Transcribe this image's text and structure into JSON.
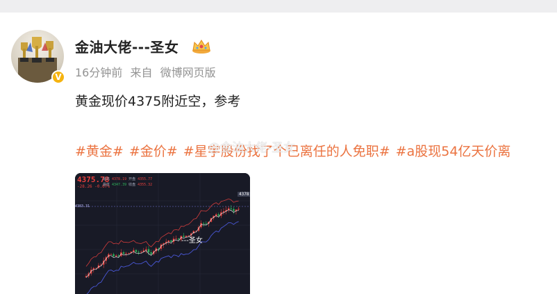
{
  "post": {
    "username": "金油大佬---圣女",
    "meta": {
      "time": "16分钟前",
      "source_prefix": "来自",
      "source": "微博网页版"
    },
    "text": "黄金现价4375附近空，参考",
    "tags": [
      "#黄金#",
      "#金价#",
      "#星宇股份找了个已离任的人免职#",
      "#a股现54亿天价离"
    ],
    "watermark": "@金油大佬-圣女"
  },
  "image": {
    "price": "4375.78",
    "change": "-28.26  -0.67%",
    "ohlc_row1": [
      "最高",
      "4378.19",
      "开盘",
      "4355.77"
    ],
    "ohlc_row2": [
      "最低",
      "4347.39",
      "收盘",
      "4355.32"
    ],
    "last_price": "4378",
    "left_price": "4383.31",
    "overlay_text": "---圣女"
  },
  "colors": {
    "tag": "#eb7340",
    "meta": "#939393",
    "chart_bg": "#181a26",
    "candle_up": "#e8403d",
    "candle_down": "#2fb35a",
    "badge": "#f5b30f"
  },
  "icons": {
    "verified": "verified-v-icon",
    "crown": "crown-icon"
  }
}
